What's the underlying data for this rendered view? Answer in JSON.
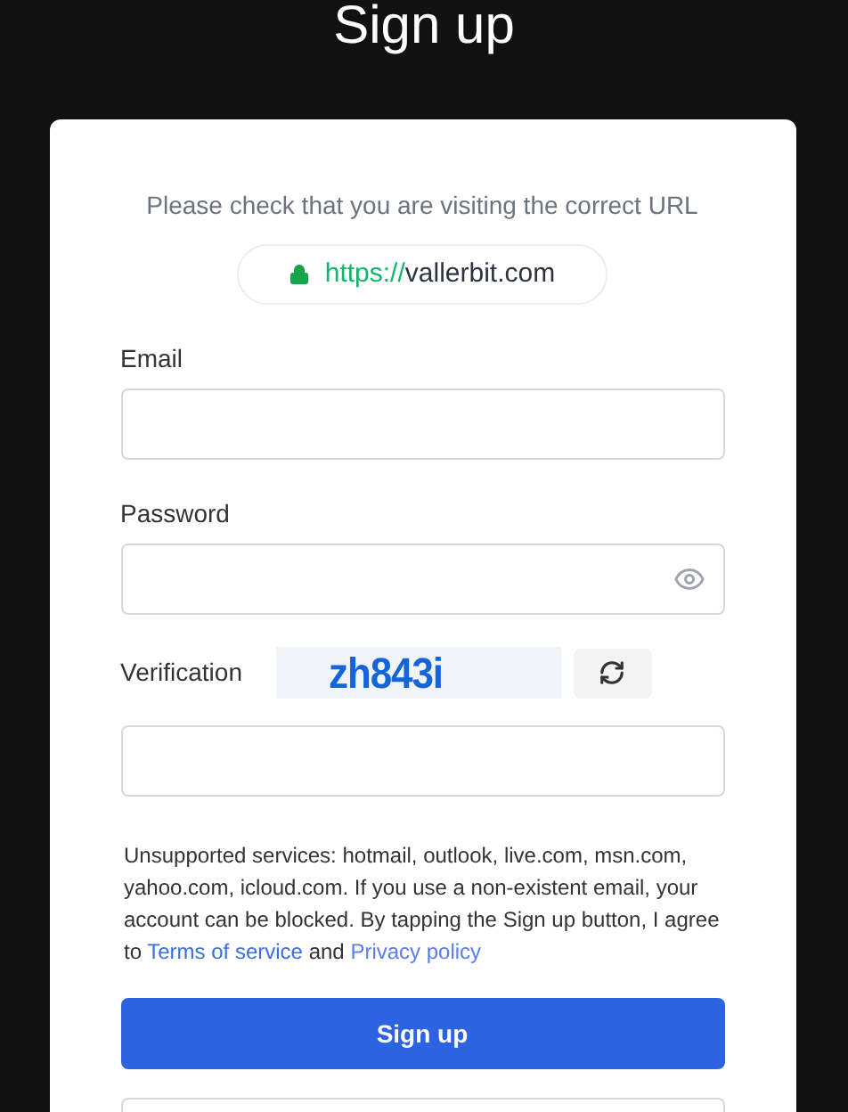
{
  "title": "Sign up",
  "url_check": {
    "message": "Please check that you are visiting the correct URL",
    "scheme": "https://",
    "domain": "vallerbit.com"
  },
  "fields": [
    {
      "label": "Email",
      "kind": "text"
    },
    {
      "label": "Password",
      "kind": "password"
    }
  ],
  "verification": {
    "label": "Verification",
    "captcha": "zh843i"
  },
  "notice": {
    "text": "Unsupported services: hotmail, outlook, live.com, msn.com, yahoo.com, icloud.com. If you use a non-existent email, your account can be blocked. By tapping the Sign up button, I agree to ",
    "terms": "Terms of service",
    "and": "and",
    "privacy": "Privacy policy"
  },
  "submit": "Sign up"
}
